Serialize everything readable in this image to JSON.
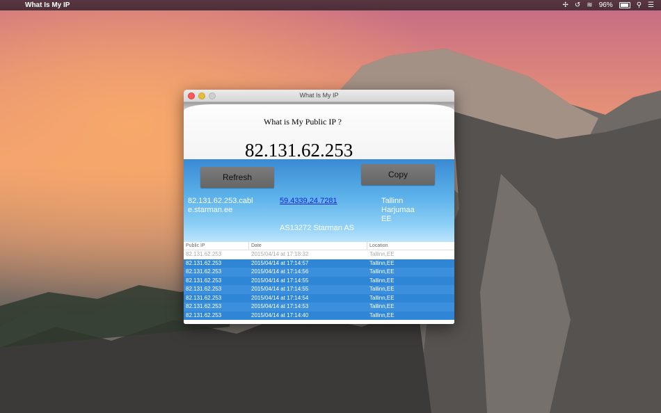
{
  "menubar": {
    "apple_icon": "apple-icon",
    "app_name": "What Is My IP",
    "status": {
      "battery_percent": "96%"
    }
  },
  "window": {
    "title": "What Is My IP",
    "question": "What is My Public IP ?",
    "ip_address": "82.131.62.253",
    "refresh_label": "Refresh",
    "copy_label": "Copy",
    "hostname": "82.131.62.253.cable.starman.ee",
    "coordinates": "59.4339,24.7281",
    "city": "Tallinn",
    "region": "Harjumaa",
    "country": "EE",
    "asn": "AS13272 Starman AS"
  },
  "history": {
    "columns": [
      "Public IP",
      "Date",
      "Location"
    ],
    "rows": [
      {
        "ip": "82.131.62.253",
        "date": "2015/04/14 at 17:18:32",
        "location": "Tallinn,EE"
      },
      {
        "ip": "82.131.62.253",
        "date": "2015/04/14 at 17:14:57",
        "location": "Tallinn,EE"
      },
      {
        "ip": "82.131.62.253",
        "date": "2015/04/14 at 17:14:56",
        "location": "Tallinn,EE"
      },
      {
        "ip": "82.131.62.253",
        "date": "2015/04/14 at 17:14:55",
        "location": "Tallinn,EE"
      },
      {
        "ip": "82.131.62.253",
        "date": "2015/04/14 at 17:14:55",
        "location": "Tallinn,EE"
      },
      {
        "ip": "82.131.62.253",
        "date": "2015/04/14 at 17:14:54",
        "location": "Tallinn,EE"
      },
      {
        "ip": "82.131.62.253",
        "date": "2015/04/14 at 17:14:53",
        "location": "Tallinn,EE"
      },
      {
        "ip": "82.131.62.253",
        "date": "2015/04/14 at 17:14:40",
        "location": "Tallinn,EE"
      }
    ]
  }
}
